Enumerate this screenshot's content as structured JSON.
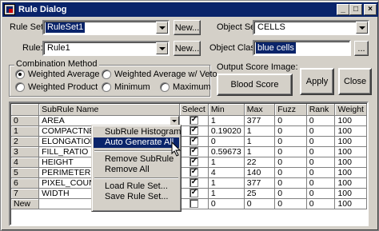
{
  "window": {
    "title": "Rule Dialog",
    "controls": [
      "_",
      "□",
      "×"
    ]
  },
  "rule_set": {
    "label": "Rule Set:",
    "value": "RuleSet1",
    "new_label": "New..."
  },
  "rule": {
    "label": "Rule:",
    "value": "Rule1",
    "new_label": "New..."
  },
  "object_set": {
    "label": "Object Set",
    "value": "CELLS"
  },
  "object_class": {
    "label": "Object Class:",
    "value": "blue cells",
    "browse_label": "..."
  },
  "combination": {
    "title": "Combination Method",
    "options": [
      {
        "label": "Weighted Average",
        "selected": true
      },
      {
        "label": "Weighted Average w/ Veto",
        "selected": false
      },
      {
        "label": "Weighted Product",
        "selected": false
      },
      {
        "label": "Minimum",
        "selected": false
      },
      {
        "label": "Maximum",
        "selected": false
      }
    ]
  },
  "output_score": {
    "label": "Output Score Image:",
    "button": "Blood Score"
  },
  "apply_label": "Apply",
  "close_label": "Close",
  "grid": {
    "columns": [
      "",
      "SubRule Name",
      "Select",
      "Min",
      "Max",
      "Fuzz",
      "Rank",
      "Weight"
    ],
    "rows": [
      {
        "id": "0",
        "name": "AREA",
        "select": true,
        "min": "1",
        "max": "377",
        "fuzz": "0",
        "rank": "0",
        "weight": "100"
      },
      {
        "id": "1",
        "name": "COMPACTNESS",
        "select": true,
        "min": "0.19020",
        "max": "1",
        "fuzz": "0",
        "rank": "0",
        "weight": "100"
      },
      {
        "id": "2",
        "name": "ELONGATION",
        "select": true,
        "min": "0",
        "max": "1",
        "fuzz": "0",
        "rank": "0",
        "weight": "100"
      },
      {
        "id": "3",
        "name": "FILL_RATIO",
        "select": true,
        "min": "0.59673",
        "max": "1",
        "fuzz": "0",
        "rank": "0",
        "weight": "100"
      },
      {
        "id": "4",
        "name": "HEIGHT",
        "select": true,
        "min": "1",
        "max": "22",
        "fuzz": "0",
        "rank": "0",
        "weight": "100"
      },
      {
        "id": "5",
        "name": "PERIMETER",
        "select": true,
        "min": "4",
        "max": "140",
        "fuzz": "0",
        "rank": "0",
        "weight": "100"
      },
      {
        "id": "6",
        "name": "PIXEL_COUNT",
        "select": true,
        "min": "1",
        "max": "377",
        "fuzz": "0",
        "rank": "0",
        "weight": "100"
      },
      {
        "id": "7",
        "name": "WIDTH",
        "select": true,
        "min": "1",
        "max": "25",
        "fuzz": "0",
        "rank": "0",
        "weight": "100"
      },
      {
        "id": "New",
        "name": "",
        "select": false,
        "min": "0",
        "max": "0",
        "fuzz": "0",
        "rank": "0",
        "weight": "100"
      }
    ]
  },
  "context_menu": {
    "items": [
      "SubRule Histogram",
      "Auto Generate All",
      "Remove SubRule",
      "Remove All",
      "Load Rule Set...",
      "Save Rule Set..."
    ],
    "highlighted": "Auto Generate All"
  },
  "colors": {
    "selection": "#0a246a",
    "face": "#d4d0c8"
  }
}
